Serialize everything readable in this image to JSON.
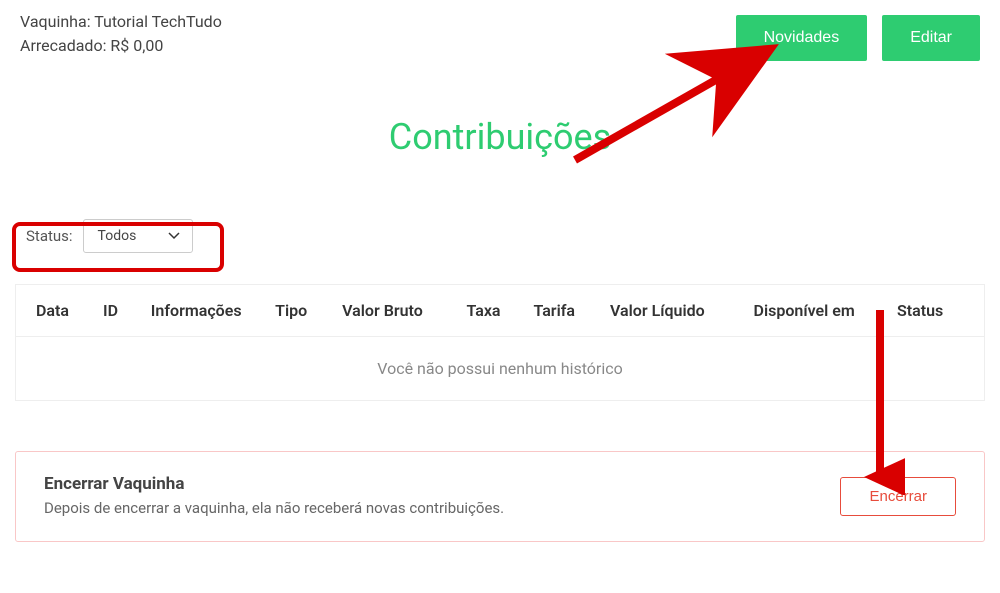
{
  "campaign": {
    "title_label": "Vaquinha: Tutorial TechTudo",
    "raised_label": "Arrecadado: R$ 0,00"
  },
  "header_buttons": {
    "novidades": "Novidades",
    "editar": "Editar"
  },
  "page_title": "Contribuições",
  "filter": {
    "label": "Status:",
    "selected": "Todos"
  },
  "table": {
    "headers": {
      "data": "Data",
      "id": "ID",
      "info": "Informações",
      "tipo": "Tipo",
      "bruto": "Valor Bruto",
      "taxa": "Taxa",
      "tarifa": "Tarifa",
      "liquido": "Valor Líquido",
      "disponivel": "Disponível em",
      "status": "Status"
    },
    "empty_message": "Você não possui nenhum histórico"
  },
  "close_section": {
    "title": "Encerrar Vaquinha",
    "description": "Depois de encerrar a vaquinha, ela não receberá novas contribuições.",
    "button": "Encerrar"
  }
}
